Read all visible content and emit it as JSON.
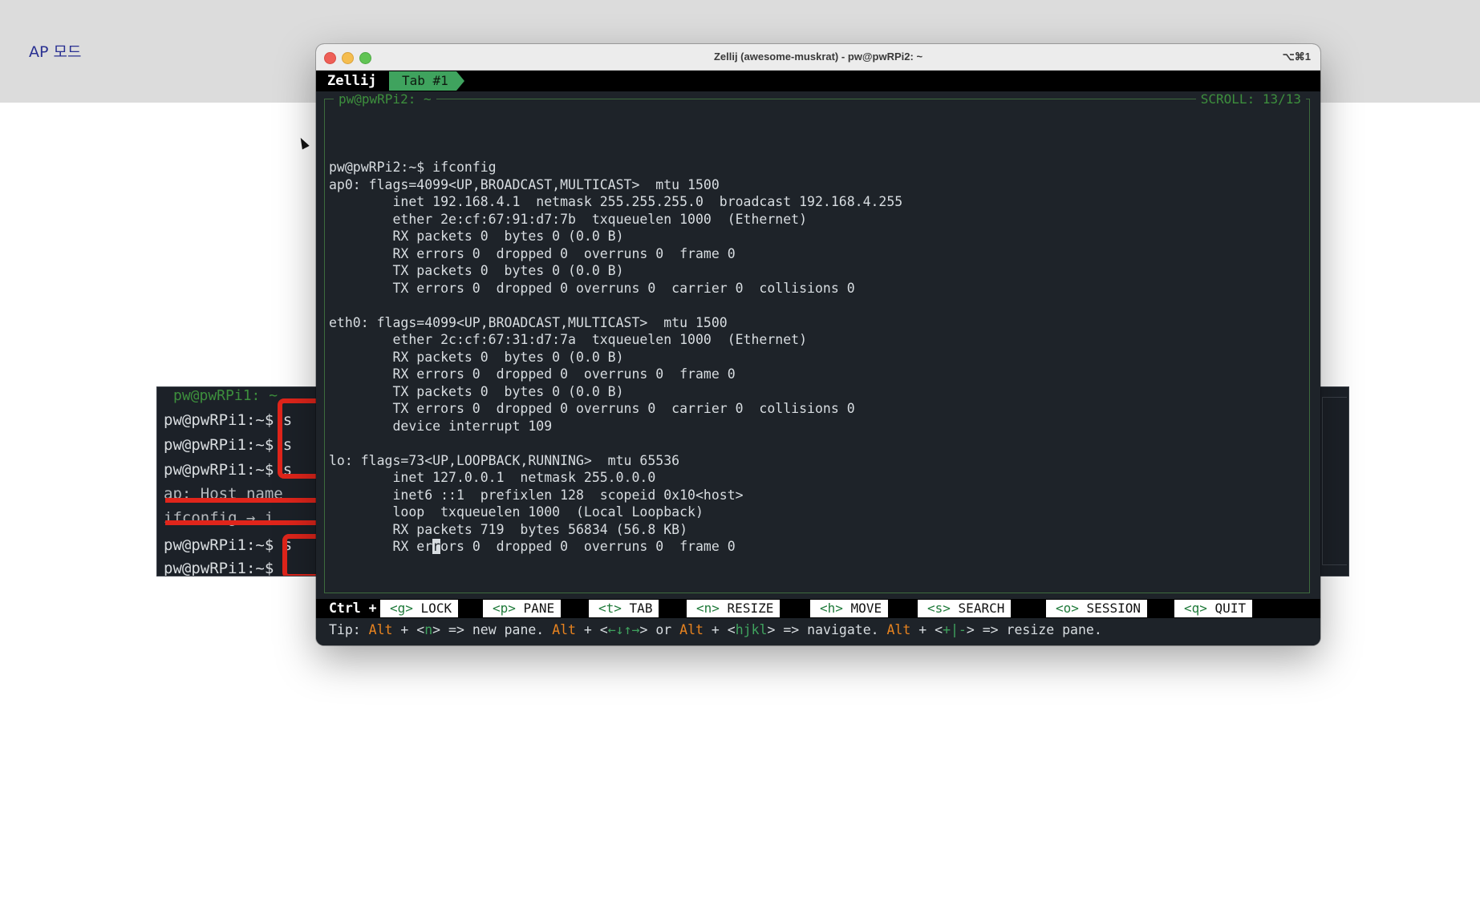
{
  "slide": {
    "title": "AP 모드"
  },
  "background_terminal": {
    "pane_title": "pw@pwRPi1: ~",
    "lines": [
      "pw@pwRPi1:~$ s",
      "pw@pwRPi1:~$ s",
      "pw@pwRPi1:~$ s",
      "ap: Host name",
      "ifconfig → i",
      "pw@pwRPi1:~$ s",
      "pw@pwRPi1:~$"
    ]
  },
  "window": {
    "title": "Zellij (awesome-muskrat) - pw@pwRPi2: ~",
    "shortcut": "⌥⌘1"
  },
  "zellij": {
    "app_label": "Zellij",
    "tab_label": "Tab #1",
    "pane_title": "pw@pwRPi2: ~",
    "scroll": "SCROLL:  13/13"
  },
  "terminal_lines": [
    "pw@pwRPi2:~$ ifconfig",
    "ap0: flags=4099<UP,BROADCAST,MULTICAST>  mtu 1500",
    "        inet 192.168.4.1  netmask 255.255.255.0  broadcast 192.168.4.255",
    "        ether 2e:cf:67:91:d7:7b  txqueuelen 1000  (Ethernet)",
    "        RX packets 0  bytes 0 (0.0 B)",
    "        RX errors 0  dropped 0  overruns 0  frame 0",
    "        TX packets 0  bytes 0 (0.0 B)",
    "        TX errors 0  dropped 0 overruns 0  carrier 0  collisions 0",
    "",
    "eth0: flags=4099<UP,BROADCAST,MULTICAST>  mtu 1500",
    "        ether 2c:cf:67:31:d7:7a  txqueuelen 1000  (Ethernet)",
    "        RX packets 0  bytes 0 (0.0 B)",
    "        RX errors 0  dropped 0  overruns 0  frame 0",
    "        TX packets 0  bytes 0 (0.0 B)",
    "        TX errors 0  dropped 0 overruns 0  carrier 0  collisions 0",
    "        device interrupt 109",
    "",
    "lo: flags=73<UP,LOOPBACK,RUNNING>  mtu 65536",
    "        inet 127.0.0.1  netmask 255.0.0.0",
    "        inet6 ::1  prefixlen 128  scopeid 0x10<host>",
    "        loop  txqueuelen 1000  (Local Loopback)",
    "        RX packets 719  bytes 56834 (56.8 KB)"
  ],
  "last_line": {
    "before": "        RX er",
    "cursor": "r",
    "after": "ors 0  dropped 0  overruns 0  frame 0"
  },
  "status_bar": {
    "ctrl_label": "Ctrl +",
    "keys": [
      {
        "key": "<g>",
        "label": "LOCK"
      },
      {
        "key": "<p>",
        "label": "PANE"
      },
      {
        "key": "<t>",
        "label": "TAB"
      },
      {
        "key": "<n>",
        "label": "RESIZE"
      },
      {
        "key": "<h>",
        "label": "MOVE"
      },
      {
        "key": "<s>",
        "label": "SEARCH"
      },
      {
        "key": "<o>",
        "label": "SESSION"
      },
      {
        "key": "<q>",
        "label": "QUIT"
      }
    ]
  },
  "tip": {
    "prefix": "Tip: ",
    "alt": "Alt",
    "plus": " + <",
    "n": "n",
    "new_pane": "> => new pane. ",
    "arrows": "←↓↑→",
    "or": "> or ",
    "hjkl": "hjkl",
    "navigate": "> => navigate. ",
    "resize_keys": "+|-",
    "resize": "> => resize pane."
  },
  "colors": {
    "accent_green": "#3fa35e",
    "accent_orange": "#e8831f",
    "annotation_red": "#e0251b"
  }
}
